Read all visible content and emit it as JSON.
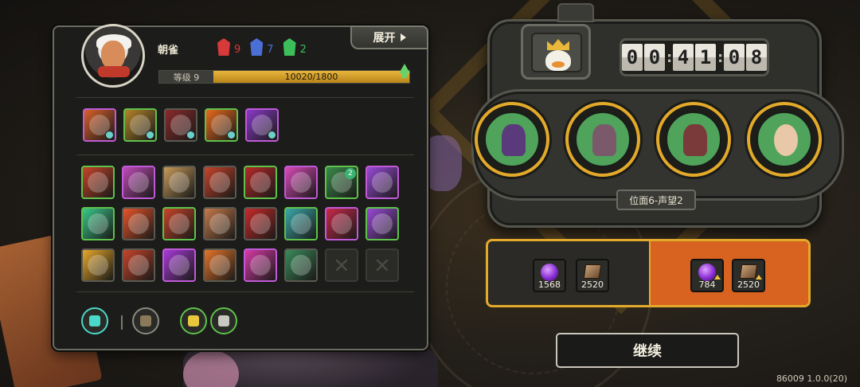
{
  "player": {
    "name": "朝雀",
    "tokens": [
      {
        "icon": "red-mask-icon",
        "color": "#d63a3a",
        "value": "9"
      },
      {
        "icon": "blue-mask-icon",
        "color": "#4a6fd6",
        "value": "7"
      },
      {
        "icon": "green-mask-icon",
        "color": "#3cbf5a",
        "value": "2"
      }
    ],
    "level_label": "等级 9",
    "exp_text": "10020/1800",
    "exp_progress": 1.0
  },
  "expand_label": "展开",
  "relics": [
    {
      "icon": "fire-claw-icon",
      "color": "#d8602a",
      "border": "#c05ad8",
      "badge": true
    },
    {
      "icon": "boot-icon",
      "color": "#b5842a",
      "border": "#5fc24a",
      "badge": true
    },
    {
      "icon": "beast-claw-icon",
      "color": "#8a2a2a",
      "border": "#5a5a52",
      "badge": true
    },
    {
      "icon": "flame-burst-icon",
      "color": "#e86a1e",
      "border": "#5fc24a",
      "badge": true
    },
    {
      "icon": "purple-orb-icon",
      "color": "#8a3ac8",
      "border": "#c05ad8",
      "badge": true
    }
  ],
  "skills": [
    {
      "icon": "claw-slash-icon",
      "color": "#c8442a",
      "border": "#5fc24a"
    },
    {
      "icon": "spellbook-icon",
      "color": "#c04ab8",
      "border": "#c05ad8"
    },
    {
      "icon": "dash-icon",
      "color": "#c89a5a",
      "border": "#5a5a52"
    },
    {
      "icon": "fire-hands-icon",
      "color": "#c8442a",
      "border": "#5a5a52"
    },
    {
      "icon": "red-slash-icon",
      "color": "#b8282a",
      "border": "#5fc24a"
    },
    {
      "icon": "pink-burst-icon",
      "color": "#d84ab8",
      "border": "#c05ad8"
    },
    {
      "icon": "hooded-figure-icon",
      "color": "#3a8a4a",
      "border": "#5fc24a",
      "level": "2"
    },
    {
      "icon": "ghost-icon",
      "color": "#9a4ad8",
      "border": "#c05ad8"
    },
    {
      "icon": "wind-icon",
      "color": "#3ac88a",
      "border": "#5fc24a"
    },
    {
      "icon": "fire-pillar-icon",
      "color": "#e8542a",
      "border": "#5a5a52"
    },
    {
      "icon": "sword-cross-icon",
      "color": "#c8442a",
      "border": "#5fc24a"
    },
    {
      "icon": "skull-icon",
      "color": "#c87a4a",
      "border": "#5a5a52"
    },
    {
      "icon": "beast-icon",
      "color": "#c82a2a",
      "border": "#5a5a52"
    },
    {
      "icon": "teal-rune-icon",
      "color": "#3aa8a8",
      "border": "#5fc24a"
    },
    {
      "icon": "red-lines-icon",
      "color": "#c82a4a",
      "border": "#c05ad8"
    },
    {
      "icon": "mask-icon",
      "color": "#9a4ad8",
      "border": "#5fc24a"
    },
    {
      "icon": "gold-slash-icon",
      "color": "#e8a82a",
      "border": "#5a5a52"
    },
    {
      "icon": "fox-icon",
      "color": "#c8442a",
      "border": "#5a5a52"
    },
    {
      "icon": "purple-spirit-icon",
      "color": "#a83ad8",
      "border": "#c05ad8"
    },
    {
      "icon": "hand-fire-icon",
      "color": "#e8742a",
      "border": "#5a5a52"
    },
    {
      "icon": "explosion-icon",
      "color": "#d83aa8",
      "border": "#c05ad8"
    },
    {
      "icon": "vine-icon",
      "color": "#3a8a5a",
      "border": "#5a5a52"
    },
    {
      "icon": "empty-slot-icon",
      "empty": true
    },
    {
      "icon": "empty-slot-icon",
      "empty": true
    }
  ],
  "bottom_icons": [
    {
      "icon": "scroll-icon",
      "color": "#4ad8c8",
      "border": "#4ad8c8"
    },
    {
      "icon": "feather-icon",
      "color": "#8a7a5a",
      "border": "#8a8a80"
    },
    {
      "icon": "spores-icon",
      "color": "#e8c83a",
      "border": "#5fc24a"
    },
    {
      "icon": "pawn-icon",
      "color": "#c8c8c0",
      "border": "#5fc24a"
    }
  ],
  "timer": {
    "h": "00",
    "m": "41",
    "s": "08"
  },
  "party": [
    {
      "icon": "dark-hood-icon",
      "color": "#5a3a7a"
    },
    {
      "icon": "helmet-icon",
      "color": "#7a5a6a"
    },
    {
      "icon": "armor-icon",
      "color": "#7a3a3a"
    },
    {
      "icon": "glasses-boy-icon",
      "color": "#e8c8a8"
    }
  ],
  "position_label": "位面6-声望2",
  "reward": {
    "left": [
      {
        "icon": "soul-orb-icon",
        "value": "1568"
      },
      {
        "icon": "card-icon",
        "value": "2520"
      }
    ],
    "right": [
      {
        "icon": "soul-orb-icon",
        "value": "784"
      },
      {
        "icon": "card-icon",
        "value": "2520"
      }
    ]
  },
  "continue_label": "继续",
  "version": "86009 1.0.0(20)",
  "colors": {
    "accent": "#e3a92a",
    "reward_highlight": "#d8621f"
  }
}
